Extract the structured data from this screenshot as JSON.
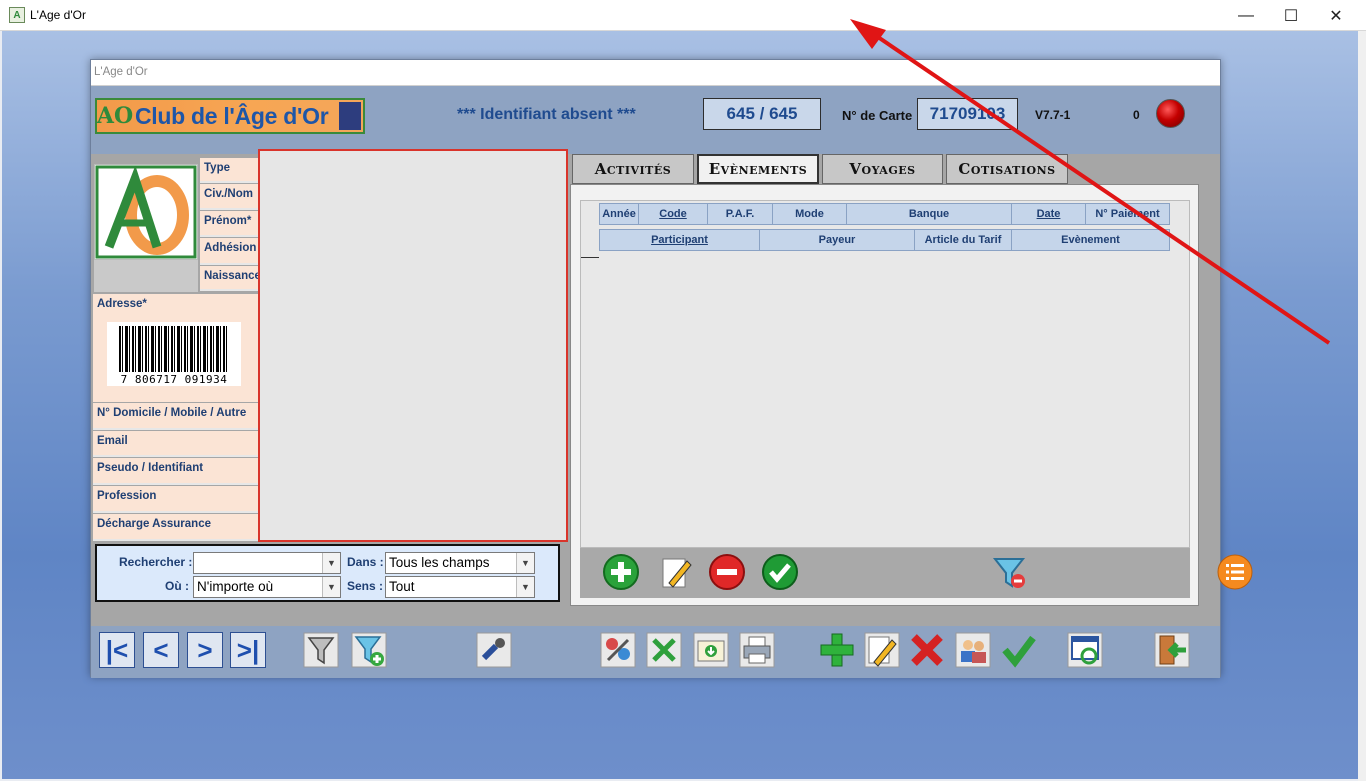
{
  "app": {
    "window_title": "L'Age d'Or",
    "inner_title": "L'Age d'Or"
  },
  "window_controls": {
    "minimize": "—",
    "maximize": "☐",
    "close": "✕"
  },
  "header": {
    "logo_text": "Club de l'Âge d'Or",
    "logo_mark": "AO",
    "ident_status": "*** Identifiant absent ***",
    "record_position": "645 / 645",
    "card_label": "N° de Carte",
    "card_number": "71709103",
    "version": "V7.7-1",
    "counter": "0",
    "status_led_color": "#c40000"
  },
  "member_fields": {
    "type": "Type",
    "civility": "Civ./Nom",
    "first_name": "Prénom*",
    "membership": "Adhésion",
    "birth": "Naissance",
    "address": "Adresse*",
    "phone": "N° Domicile / Mobile / Autre",
    "email": "Email",
    "pseudo": "Pseudo / Identifiant",
    "profession": "Profession",
    "insurance": "Décharge Assurance"
  },
  "barcode": {
    "digits": "7 806717 091934"
  },
  "search": {
    "search_label": "Rechercher :",
    "search_value": "",
    "where_label": "Où :",
    "where_value": "N'importe où",
    "in_label": "Dans :",
    "in_value": "Tous les champs",
    "direction_label": "Sens :",
    "direction_value": "Tout"
  },
  "tabs": [
    {
      "label": "Activités",
      "active": false
    },
    {
      "label": "Evènements",
      "active": true
    },
    {
      "label": "Voyages",
      "active": false
    },
    {
      "label": "Cotisations",
      "active": false
    }
  ],
  "grid": {
    "row1": [
      "Année",
      "Code",
      "P.A.F.",
      "Mode",
      "Banque",
      "Date",
      "N° Paiement"
    ],
    "row2": [
      "Participant",
      "Payeur",
      "Article du Tarif",
      "Evènement"
    ]
  },
  "grid_toolbar_icons": [
    "add-icon",
    "edit-icon",
    "remove-icon",
    "validate-icon",
    "filter-remove-icon",
    "list-icon"
  ],
  "footer_icons": [
    "first-record-icon",
    "previous-record-icon",
    "next-record-icon",
    "last-record-icon",
    "filter-icon",
    "filter-add-icon",
    "connect-icon",
    "tools-icon",
    "excel-icon",
    "export-icon",
    "print-icon",
    "add-record-icon",
    "edit-record-icon",
    "delete-record-icon",
    "users-icon",
    "confirm-icon",
    "refresh-icon",
    "exit-icon"
  ],
  "colors": {
    "field_label_bg": "#fbe4d5",
    "header_bg": "#8ea3c2",
    "accent_blue": "#1f4b8f",
    "annotation_arrow": "#e01515"
  }
}
